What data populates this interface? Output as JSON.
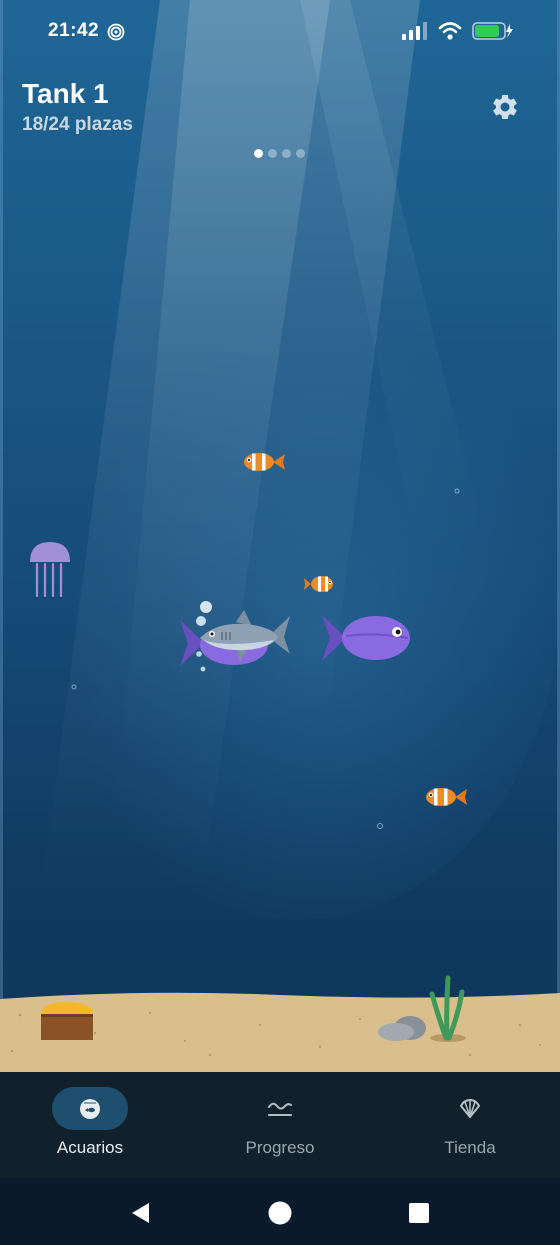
{
  "status_bar": {
    "time": "21:42"
  },
  "tank": {
    "name": "Tank 1",
    "capacity": "18/24 plazas",
    "pages": {
      "total": 4,
      "current": 1
    }
  },
  "nav": {
    "items": [
      {
        "label": "Acuarios",
        "icon": "fishbowl-icon",
        "active": true
      },
      {
        "label": "Progreso",
        "icon": "progress-icon",
        "active": false
      },
      {
        "label": "Tienda",
        "icon": "shell-icon",
        "active": false
      }
    ]
  },
  "colors": {
    "accent": "#1e4f6e",
    "nav_background": "#12202b",
    "water_top": "#1f6696",
    "water_bottom": "#0e3558",
    "sand": "#d9bf8c"
  }
}
